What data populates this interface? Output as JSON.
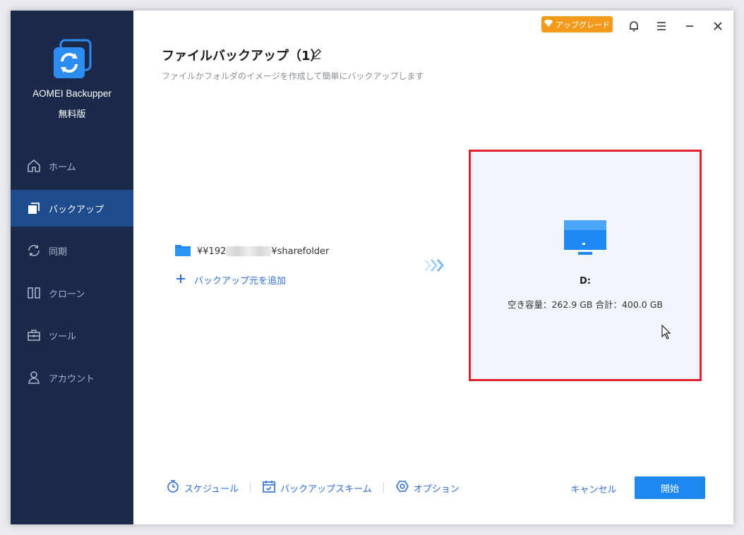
{
  "app": {
    "name": "AOMEI Backupper",
    "edition": "無料版"
  },
  "titlebar": {
    "upgrade_label": "アップグレード"
  },
  "sidebar": {
    "items": [
      {
        "label": "ホーム",
        "icon": "home-icon"
      },
      {
        "label": "バックアップ",
        "icon": "backup-icon"
      },
      {
        "label": "同期",
        "icon": "sync-icon"
      },
      {
        "label": "クローン",
        "icon": "clone-icon"
      },
      {
        "label": "ツール",
        "icon": "toolbox-icon"
      },
      {
        "label": "アカウント",
        "icon": "user-icon"
      }
    ]
  },
  "page": {
    "title": "ファイルバックアップ（1）",
    "subtitle": "ファイルかフォルダのイメージを作成して簡単にバックアップします"
  },
  "source": {
    "path_prefix": "¥¥192",
    "path_suffix": "¥sharefolder",
    "add_label": "バックアップ元を追加"
  },
  "destination": {
    "label": "D:",
    "info": "空き容量：262.9 GB 合計：400.0 GB"
  },
  "footer": {
    "schedule_label": "スケジュール",
    "scheme_label": "バックアップスキーム",
    "options_label": "オプション",
    "cancel_label": "キャンセル",
    "start_label": "開始"
  },
  "colors": {
    "sidebar_bg": "#1b2a4a",
    "sidebar_active": "#1e4c8c",
    "accent": "#1e88f0",
    "upgrade": "#f39a1b",
    "highlight_border": "#e0202a"
  }
}
